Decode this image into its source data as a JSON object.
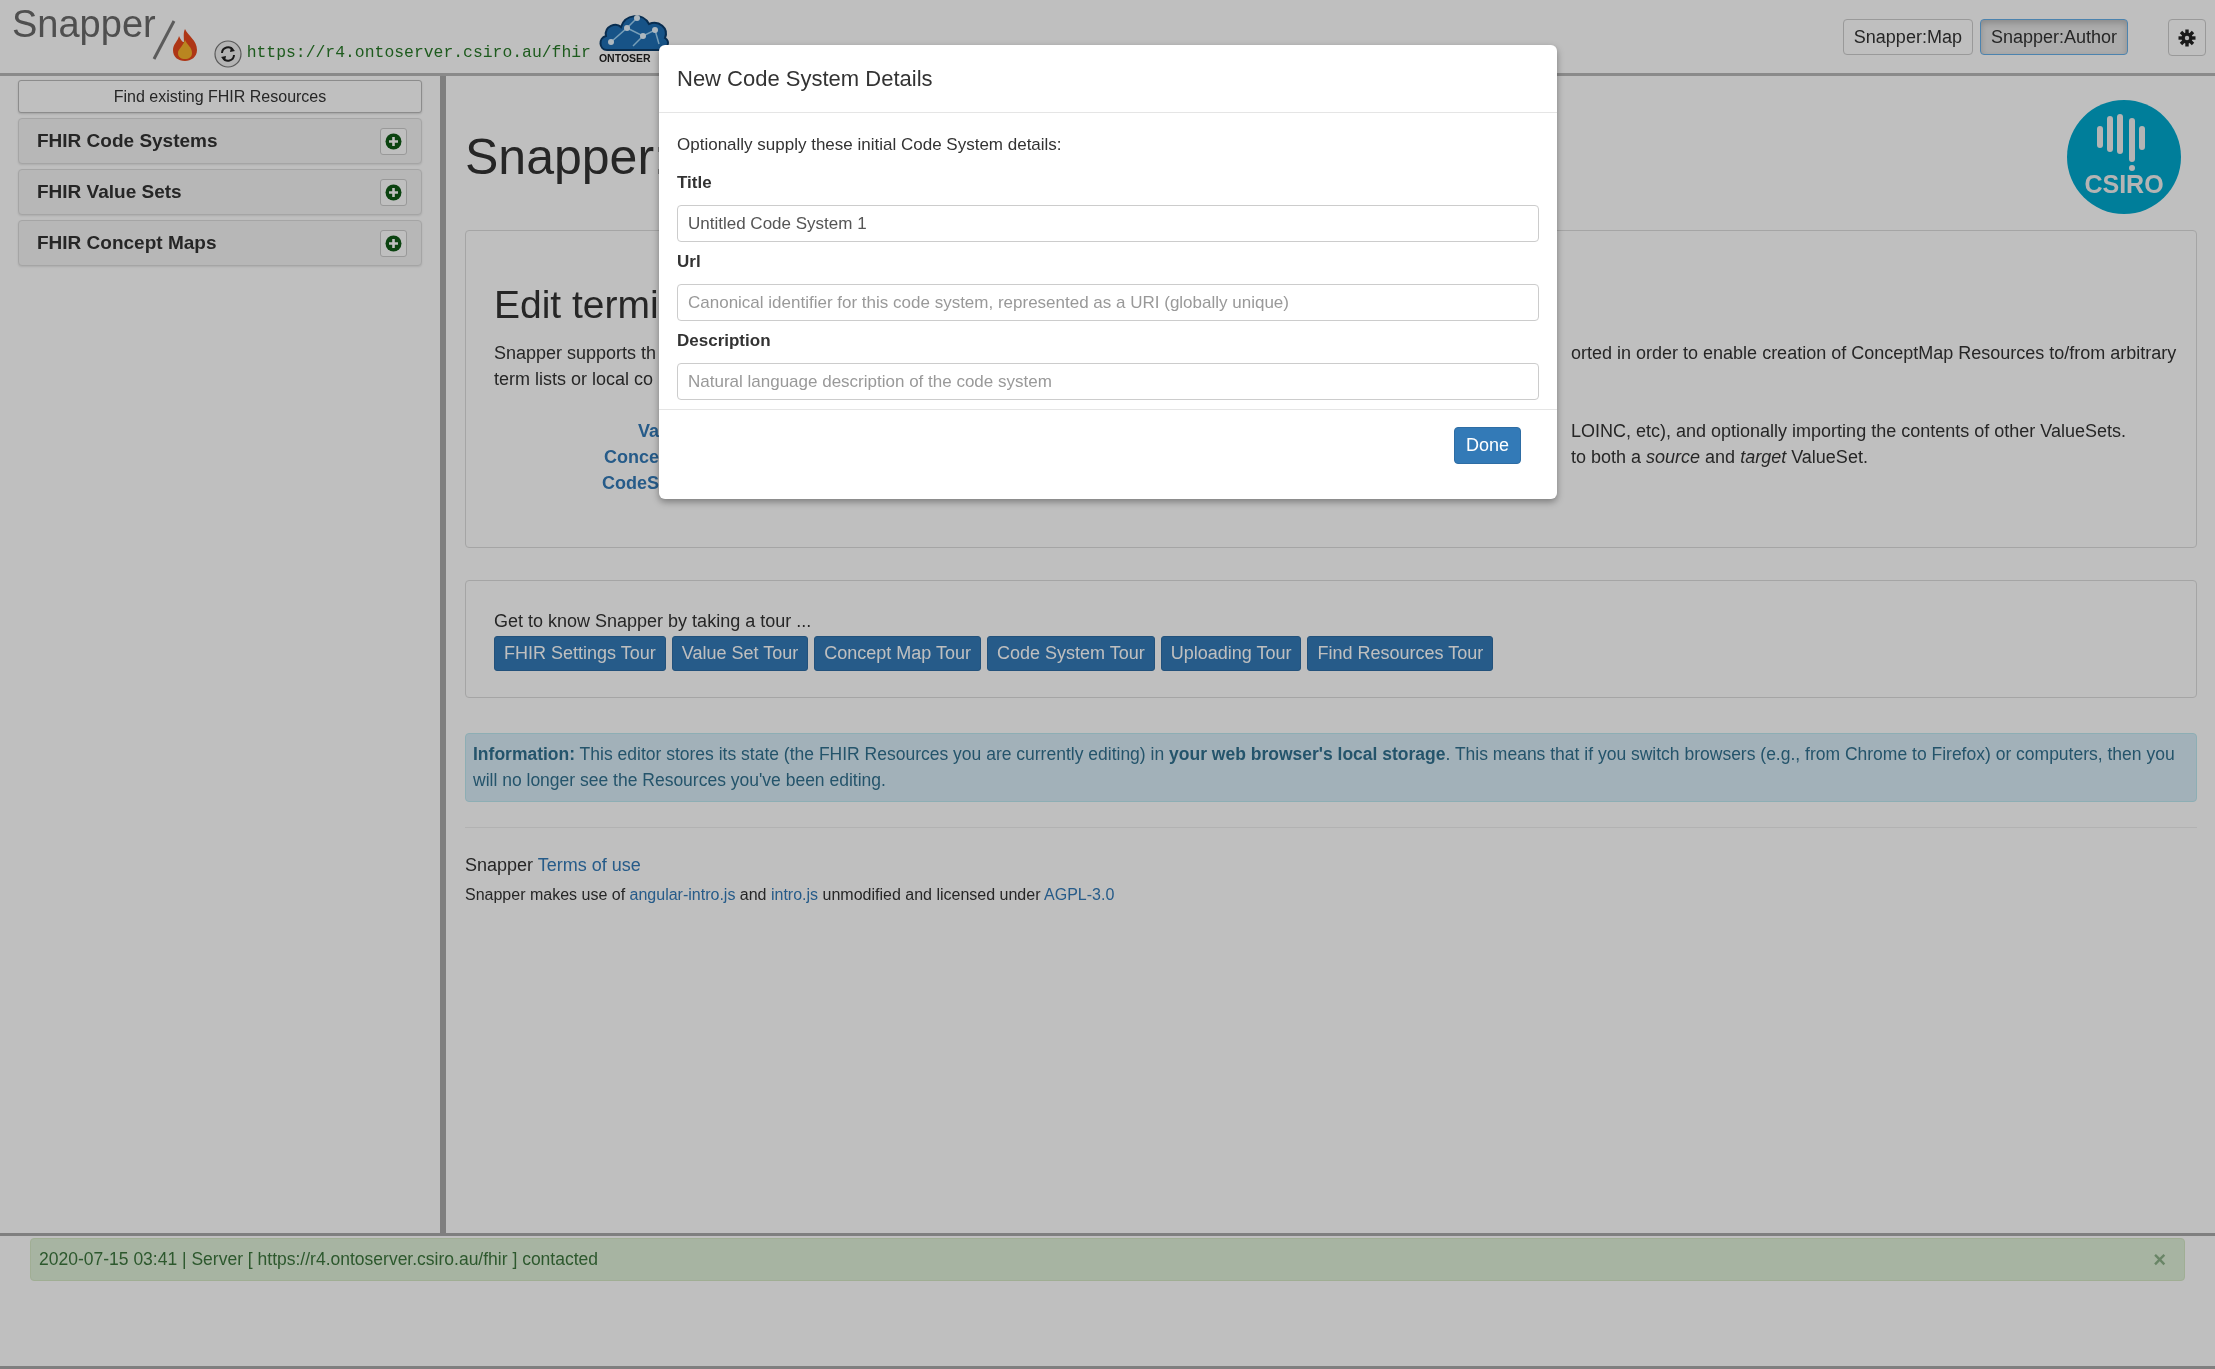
{
  "header": {
    "brand": "Snapper",
    "server_url": "https://r4.ontoserver.csiro.au/fhir",
    "server_logo_text": "ONTOSER",
    "apps": [
      {
        "label": "Snapper:Map",
        "selected": false
      },
      {
        "label": "Snapper:Author",
        "selected": true
      }
    ]
  },
  "sidebar": {
    "find_button": "Find existing FHIR Resources",
    "panels": [
      {
        "title": "FHIR Code Systems"
      },
      {
        "title": "FHIR Value Sets"
      },
      {
        "title": "FHIR Concept Maps"
      }
    ]
  },
  "main": {
    "title": "Snapper:",
    "logo_text": "CSIRO",
    "intro": {
      "heading": "Edit termi",
      "rows": [
        {
          "kind": "text",
          "left": "Snapper supports th",
          "right": "orted in order to enable creation of ConceptMap Resources to/from arbitrary"
        },
        {
          "kind": "text",
          "left": "term lists or local co"
        },
        {
          "kind": "feature",
          "left": "Va",
          "right": "LOINC, etc), and optionally importing the contents of other ValueSets."
        },
        {
          "kind": "feature",
          "left": "Conce",
          "right": "to both a *source* and *target* ValueSet."
        },
        {
          "kind": "feature",
          "left": "CodeS"
        }
      ]
    },
    "tour": {
      "prompt": "Get to know Snapper by taking a tour ...",
      "buttons": [
        "FHIR Settings Tour",
        "Value Set Tour",
        "Concept Map Tour",
        "Code System Tour",
        "Uploading Tour",
        "Find Resources Tour"
      ]
    },
    "info": "**Information:** This editor stores its state (the FHIR Resources you are currently editing) in **your web browser's local storage**. This means that if you switch browsers (e.g., from Chrome to Firefox) or computers, then you will no longer see the Resources you've been editing.",
    "footer": [
      [
        {
          "kind": "text",
          "text": "Snapper "
        },
        {
          "kind": "link",
          "text": "Terms of use"
        }
      ],
      [
        {
          "kind": "text",
          "text": "Snapper makes use of "
        },
        {
          "kind": "link",
          "text": "angular-intro.js"
        },
        {
          "kind": "text",
          "text": " and "
        },
        {
          "kind": "link",
          "text": "intro.js"
        },
        {
          "kind": "text",
          "text": " unmodified and licensed under "
        },
        {
          "kind": "link",
          "text": "AGPL-3.0"
        }
      ]
    ]
  },
  "status_bar": {
    "message": "2020-07-15 03:41 | Server [ https://r4.ontoserver.csiro.au/fhir ] contacted",
    "close": "×"
  },
  "modal": {
    "title": "New Code System Details",
    "prompt": "Optionally supply these initial Code System details:",
    "fields": [
      {
        "label": "Title",
        "value": "Untitled Code System 1"
      },
      {
        "label": "Url",
        "placeholder": "Canonical identifier for this code system, represented as a URI (globally unique)"
      },
      {
        "label": "Description",
        "placeholder": "Natural language description of the code system"
      }
    ],
    "done_button": "Done"
  }
}
